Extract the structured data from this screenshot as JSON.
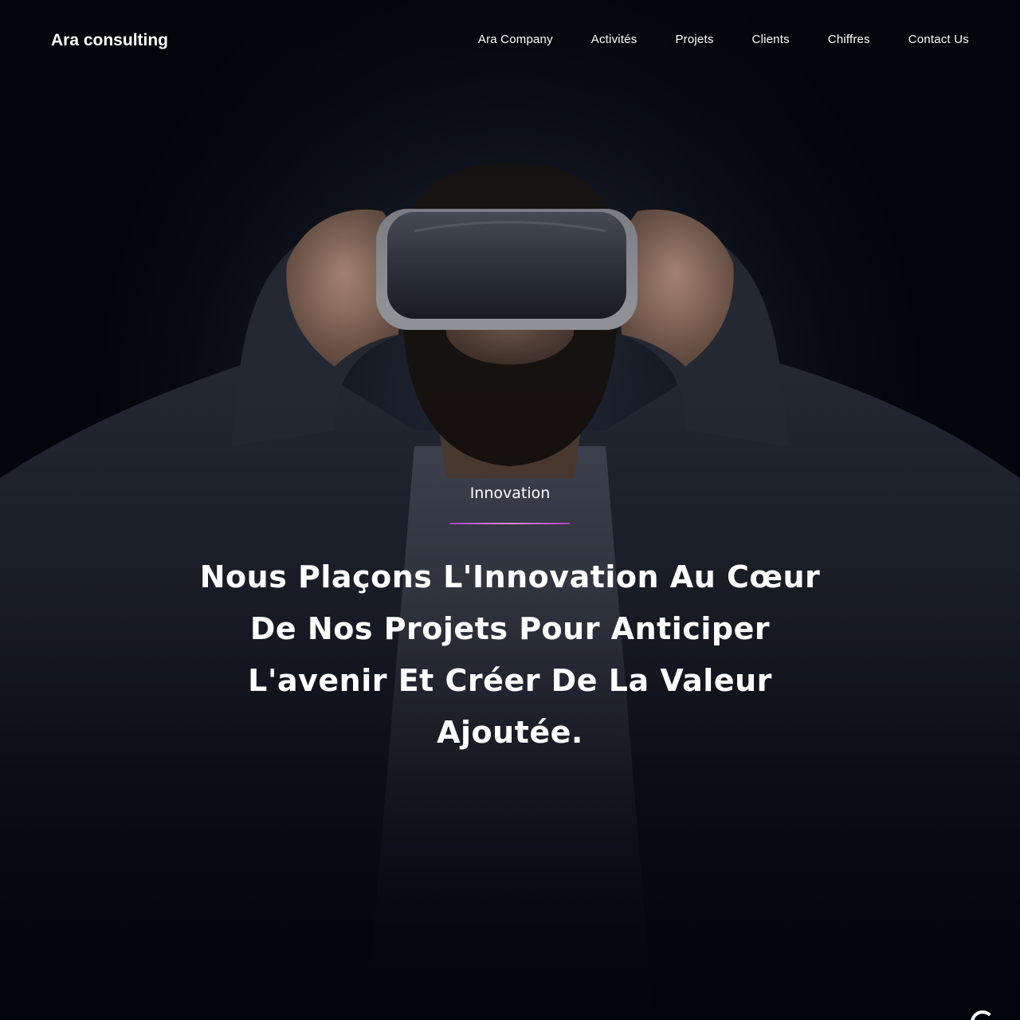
{
  "brand": {
    "name": "Ara consulting"
  },
  "nav": {
    "items": [
      {
        "label": "Ara Company"
      },
      {
        "label": "Activités"
      },
      {
        "label": "Projets"
      },
      {
        "label": "Clients"
      },
      {
        "label": "Chiffres"
      },
      {
        "label": "Contact Us"
      }
    ]
  },
  "hero": {
    "eyebrow": "Innovation",
    "headline": "Nous Plaçons L'Innovation Au Cœur De Nos Projets Pour Anticiper L'avenir Et Créer De La Valeur Ajoutée.",
    "image_subject": "man-wearing-vr-headset",
    "accent_color": "#c04fd6"
  },
  "icons": {
    "scroll": "scroll-progress-icon"
  }
}
